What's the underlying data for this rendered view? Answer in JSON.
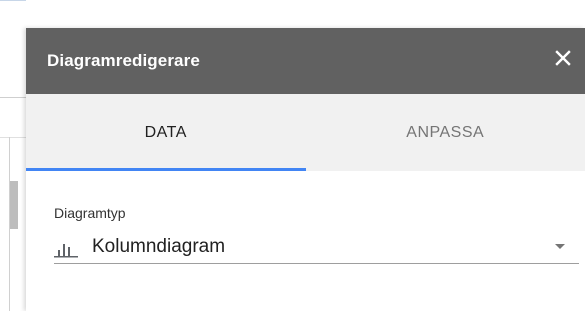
{
  "panel": {
    "title": "Diagramredigerare",
    "close_icon": "close-icon"
  },
  "tabs": [
    {
      "label": "DATA",
      "active": true
    },
    {
      "label": "ANPASSA",
      "active": false
    }
  ],
  "chart_type": {
    "label": "Diagramtyp",
    "value": "Kolumndiagram",
    "icon": "column-chart-icon"
  },
  "colors": {
    "header_bg": "#616161",
    "tab_bg": "#f1f1f1",
    "active_tab_indicator": "#4285f4"
  }
}
